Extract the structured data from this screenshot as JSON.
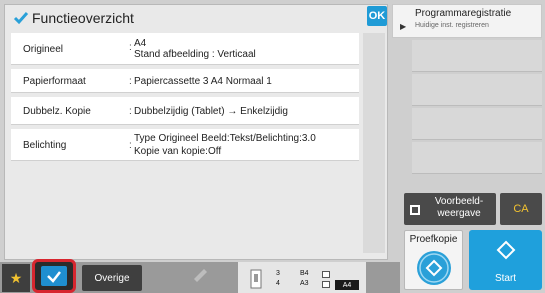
{
  "panel": {
    "title": "Functieoverzicht",
    "ok_label": "OK",
    "rows": [
      {
        "label": "Origineel",
        "value_lines": [
          "A4",
          "Stand afbeelding : Verticaal"
        ]
      },
      {
        "label": "Papierformaat",
        "value_lines": [
          "Papiercassette 3  A4  Normaal 1"
        ]
      },
      {
        "label": "Dubbelz. Kopie",
        "value_lines": [
          "Dubbelzijdig (Tablet) → Enkelzijdig"
        ]
      },
      {
        "label": "Belichting",
        "value_lines": [
          "Type Origineel Beeld:Tekst/Belichting:3.0",
          "Kopie van kopie:Off"
        ]
      }
    ],
    "colon": ":"
  },
  "right": {
    "program_title": "Programmaregistratie",
    "program_sub": "Huidige inst. registreren",
    "preview_label": "Voorbeeld-\nweergave",
    "ca_label": "CA",
    "proof_label": "Proefkopie",
    "start_label": "Start"
  },
  "bottom": {
    "star_icon": "star-icon",
    "overige_label": "Overige",
    "trays": [
      {
        "num": "3",
        "size": "B4"
      },
      {
        "num": "4",
        "size": "A3"
      }
    ],
    "paper_badge": "A4"
  },
  "colors": {
    "accent_blue": "#1fa0dc",
    "highlight_red": "#d7262f",
    "ca_yellow": "#f2c230"
  }
}
